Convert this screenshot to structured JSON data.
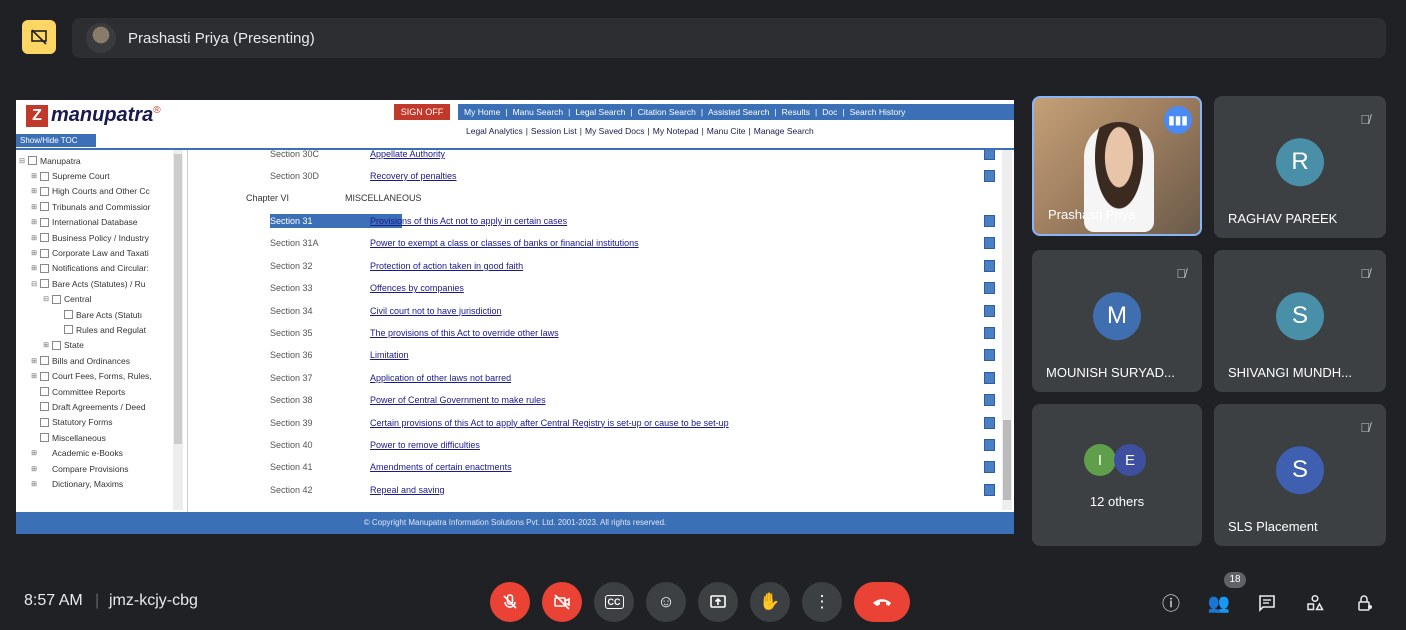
{
  "presenter": {
    "name": "Prashasti Priya (Presenting)"
  },
  "manupatra": {
    "logo_text": "manupatra",
    "logo_reg": "®",
    "toc_toggle": "Show/Hide TOC",
    "sign_off": "SIGN OFF",
    "nav_primary": [
      "My Home",
      "Manu Search",
      "Legal Search",
      "Citation Search",
      "Assisted Search",
      "Results",
      "Doc",
      "Search History"
    ],
    "nav_secondary": [
      "Legal Analytics",
      "Session List",
      "My Saved Docs",
      "My Notepad",
      "Manu Cite",
      "Manage Search"
    ],
    "toc_items": [
      {
        "label": "Manupatra",
        "indent": 0,
        "exp": "⊟"
      },
      {
        "label": "Supreme Court",
        "indent": 1,
        "exp": "⊞"
      },
      {
        "label": "High Courts and Other Cc",
        "indent": 1,
        "exp": "⊞"
      },
      {
        "label": "Tribunals and Commissior",
        "indent": 1,
        "exp": "⊞"
      },
      {
        "label": "International Database",
        "indent": 1,
        "exp": "⊞"
      },
      {
        "label": "Business Policy / Industry",
        "indent": 1,
        "exp": "⊞"
      },
      {
        "label": "Corporate Law and Taxati",
        "indent": 1,
        "exp": "⊞"
      },
      {
        "label": "Notifications and Circular:",
        "indent": 1,
        "exp": "⊞"
      },
      {
        "label": "Bare Acts (Statutes) / Ru",
        "indent": 1,
        "exp": "⊟"
      },
      {
        "label": "Central",
        "indent": 2,
        "exp": "⊟"
      },
      {
        "label": "Bare Acts (Statutı",
        "indent": 3,
        "exp": ""
      },
      {
        "label": "Rules and Regulat",
        "indent": 3,
        "exp": ""
      },
      {
        "label": "State",
        "indent": 2,
        "exp": "⊞"
      },
      {
        "label": "Bills and Ordinances",
        "indent": 1,
        "exp": "⊞"
      },
      {
        "label": "Court Fees, Forms, Rules,",
        "indent": 1,
        "exp": "⊞"
      },
      {
        "label": "Committee Reports",
        "indent": 1,
        "exp": ""
      },
      {
        "label": "Draft Agreements / Deed",
        "indent": 1,
        "exp": ""
      },
      {
        "label": "Statutory Forms",
        "indent": 1,
        "exp": ""
      },
      {
        "label": "Miscellaneous",
        "indent": 1,
        "exp": ""
      },
      {
        "label": "Academic e-Books",
        "indent": 1,
        "exp": "⊞",
        "nocb": true
      },
      {
        "label": "Compare Provisions",
        "indent": 1,
        "exp": "⊞",
        "nocb": true
      },
      {
        "label": "Dictionary, Maxims",
        "indent": 1,
        "exp": "⊞",
        "nocb": true
      }
    ],
    "chapter": {
      "num": "Chapter VI",
      "title": "MISCELLANEOUS"
    },
    "sections_top": [
      {
        "num": "Section 30C",
        "title": "Appellate Authority"
      },
      {
        "num": "Section 30D",
        "title": "Recovery of penalties"
      }
    ],
    "sections": [
      {
        "num": "Section 31",
        "title": "Provisions of this Act not to apply in certain cases",
        "highlight": true
      },
      {
        "num": "Section 31A",
        "title": "Power to exempt a class or classes of banks or financial institutions"
      },
      {
        "num": "Section 32",
        "title": "Protection of action taken in good faith"
      },
      {
        "num": "Section 33",
        "title": "Offences by companies"
      },
      {
        "num": "Section 34",
        "title": "Civil court not to have jurisdiction"
      },
      {
        "num": "Section 35",
        "title": "The provisions of this Act to override other laws"
      },
      {
        "num": "Section 36",
        "title": "Limitation"
      },
      {
        "num": "Section 37",
        "title": "Application of other laws not barred"
      },
      {
        "num": "Section 38",
        "title": "Power of Central Government to make rules"
      },
      {
        "num": "Section 39",
        "title": "Certain provisions of this Act to apply after Central Registry is set-up or cause to be set-up"
      },
      {
        "num": "Section 40",
        "title": "Power to remove difficulties"
      },
      {
        "num": "Section 41",
        "title": "Amendments of certain enactments"
      },
      {
        "num": "Section 42",
        "title": "Repeal and saving"
      }
    ],
    "footer": "© Copyright Manupatra Information Solutions Pvt. Ltd. 2001-2023. All rights reserved."
  },
  "participants": [
    {
      "name": "Prashasti Priya",
      "video": true
    },
    {
      "name": "RAGHAV PAREEK",
      "initial": "R",
      "color": "#4a8fa8",
      "muted": true
    },
    {
      "name": "MOUNISH SURYAD...",
      "initial": "M",
      "color": "#3f6fb0",
      "muted": true
    },
    {
      "name": "SHIVANGI MUNDH...",
      "initial": "S",
      "color": "#4a8fa8",
      "muted": true
    },
    {
      "name": "12 others",
      "mini": [
        {
          "initial": "I",
          "color": "#5f9e4a"
        },
        {
          "initial": "E",
          "color": "#3f4fa0"
        }
      ]
    },
    {
      "name": "SLS Placement",
      "initial": "S",
      "color": "#3f5fb0",
      "muted": true
    }
  ],
  "meeting": {
    "time": "8:57 AM",
    "code": "jmz-kcjy-cbg",
    "people_count": "18"
  },
  "icons": {
    "mute": "mic-off-icon",
    "cam": "camera-off-icon",
    "cc": "captions-icon",
    "emoji": "emoji-icon",
    "present": "present-icon",
    "hand": "raise-hand-icon",
    "more": "more-icon",
    "end": "end-call-icon"
  }
}
